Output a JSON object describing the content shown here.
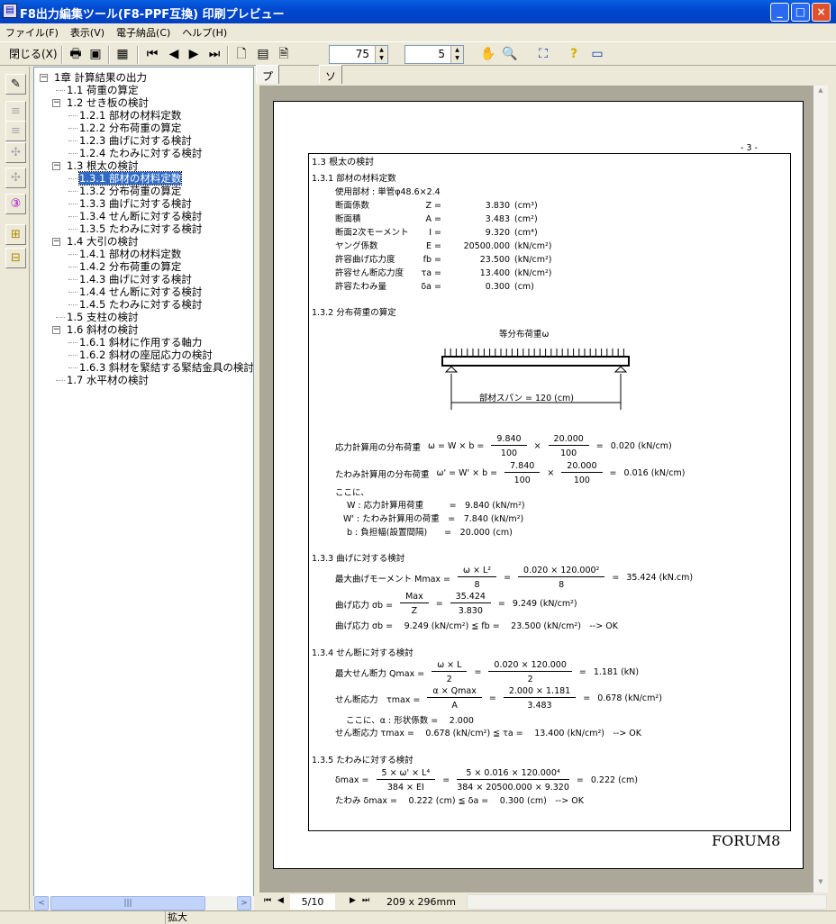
{
  "window": {
    "title": "F8出力編集ツール(F8-PPF互換) 印刷プレビュー",
    "minimize": "_",
    "maximize": "□",
    "close": "×"
  },
  "menu": [
    "ファイル(F)",
    "表示(V)",
    "電子納品(C)",
    "ヘルプ(H)"
  ],
  "toolbar": {
    "close_label": "閉じる(X)",
    "zoom_value": "75",
    "page_value": "5",
    "icons": {
      "print": "printer-icon",
      "save": "save-icon",
      "export": "export-icon",
      "first": "first-page-icon",
      "prev": "prev-page-icon",
      "next": "next-page-icon",
      "last": "last-page-icon",
      "page1": "page-single-icon",
      "page2": "page-double-icon",
      "page3": "page-fold-icon",
      "hand": "hand-icon",
      "zoom": "magnifier-icon",
      "fit": "fit-icon",
      "help": "help-icon",
      "info": "info-icon"
    }
  },
  "tree": [
    {
      "label": "1章 計算結果の出力",
      "level": 0,
      "expander": true
    },
    {
      "label": "1.1 荷重の算定",
      "level": 1
    },
    {
      "label": "1.2 せき板の検討",
      "level": 1,
      "expander": true
    },
    {
      "label": "1.2.1 部材の材料定数",
      "level": 2
    },
    {
      "label": "1.2.2 分布荷重の算定",
      "level": 2
    },
    {
      "label": "1.2.3 曲げに対する検討",
      "level": 2
    },
    {
      "label": "1.2.4 たわみに対する検討",
      "level": 2
    },
    {
      "label": "1.3 根太の検討",
      "level": 1,
      "expander": true
    },
    {
      "label": "1.3.1 部材の材料定数",
      "level": 2,
      "selected": true
    },
    {
      "label": "1.3.2 分布荷重の算定",
      "level": 2
    },
    {
      "label": "1.3.3 曲げに対する検討",
      "level": 2
    },
    {
      "label": "1.3.4 せん断に対する検討",
      "level": 2
    },
    {
      "label": "1.3.5 たわみに対する検討",
      "level": 2
    },
    {
      "label": "1.4 大引の検討",
      "level": 1,
      "expander": true
    },
    {
      "label": "1.4.1 部材の材料定数",
      "level": 2
    },
    {
      "label": "1.4.2 分布荷重の算定",
      "level": 2
    },
    {
      "label": "1.4.3 曲げに対する検討",
      "level": 2
    },
    {
      "label": "1.4.4 せん断に対する検討",
      "level": 2
    },
    {
      "label": "1.4.5 たわみに対する検討",
      "level": 2
    },
    {
      "label": "1.5 支柱の検討",
      "level": 1
    },
    {
      "label": "1.6 斜材の検討",
      "level": 1,
      "expander": true
    },
    {
      "label": "1.6.1 斜材に作用する軸力",
      "level": 2
    },
    {
      "label": "1.6.2 斜材の座屈応力の検討",
      "level": 2
    },
    {
      "label": "1.6.3 斜材を緊結する緊結金具の検討",
      "level": 2
    },
    {
      "label": "1.7 水平材の検討",
      "level": 1
    }
  ],
  "tabs": [
    "プレビュー",
    "ソース"
  ],
  "document": {
    "page_number": "- 3 -",
    "heading": "1.3 根太の検討",
    "s1": {
      "title": "1.3.1 部材の材料定数",
      "member": "使用部材 : 単管φ48.6×2.4",
      "rows": [
        {
          "label": "断面係数",
          "sym": "Z =",
          "value": "3.830",
          "unit": "(cm³)"
        },
        {
          "label": "断面積",
          "sym": "A =",
          "value": "3.483",
          "unit": "(cm²)"
        },
        {
          "label": "断面2次モーメント",
          "sym": "I =",
          "value": "9.320",
          "unit": "(cm⁴)"
        },
        {
          "label": "ヤング係数",
          "sym": "E =",
          "value": "20500.000",
          "unit": "(kN/cm²)"
        },
        {
          "label": "許容曲げ応力度",
          "sym": "fb =",
          "value": "23.500",
          "unit": "(kN/cm²)"
        },
        {
          "label": "許容せん断応力度",
          "sym": "τa =",
          "value": "13.400",
          "unit": "(kN/cm²)"
        },
        {
          "label": "許容たわみ量",
          "sym": "δa =",
          "value": "0.300",
          "unit": "(cm)"
        }
      ]
    },
    "s2": {
      "title": "1.3.2 分布荷重の算定",
      "load_label": "等分布荷重ω",
      "span_label": "部材スパン = 120 (cm)",
      "f1": [
        {
          "t": "応力計算用の分布荷重"
        },
        {
          "t": "ω = W × b ="
        },
        {
          "n": "9.840",
          "d": "100"
        },
        {
          "t": "×"
        },
        {
          "n": "20.000",
          "d": "100"
        },
        {
          "t": "="
        },
        {
          "t": "0.020 (kN/cm)"
        }
      ],
      "f2": [
        {
          "t": "たわみ計算用の分布荷重"
        },
        {
          "t": "ω' = W' × b ="
        },
        {
          "n": "7.840",
          "d": "100"
        },
        {
          "t": "×"
        },
        {
          "n": "20.000",
          "d": "100"
        },
        {
          "t": "="
        },
        {
          "t": "0.016 (kN/cm)"
        }
      ],
      "where": "ここに、",
      "defs": [
        "W : 応力計算用荷重　　　=　9.840 (kN/m²)",
        "W' : たわみ計算用の荷重　=　7.840 (kN/m²)",
        "b : 負担幅(設置間隔)　　=　20.000 (cm)"
      ]
    },
    "s3": {
      "title": "1.3.3 曲げに対する検討",
      "f1": [
        {
          "t": "最大曲げモーメント Mmax ="
        },
        {
          "n": "ω × L²",
          "d": "8"
        },
        {
          "t": "="
        },
        {
          "n": "0.020 × 120.000²",
          "d": "8"
        },
        {
          "t": "="
        },
        {
          "t": "35.424 (kN.cm)"
        }
      ],
      "f2": [
        {
          "t": "曲げ応力 σb ="
        },
        {
          "n": "Max",
          "d": "Z"
        },
        {
          "t": "="
        },
        {
          "n": "35.424",
          "d": "3.830"
        },
        {
          "t": "="
        },
        {
          "t": "9.249 (kN/cm²)"
        }
      ],
      "check": "曲げ応力 σb =　 9.249 (kN/cm²) ≦ fb =　 23.500 (kN/cm²)　--> OK"
    },
    "s4": {
      "title": "1.3.4 せん断に対する検討",
      "f1": [
        {
          "t": "最大せん断力 Qmax ="
        },
        {
          "n": "ω × L",
          "d": "2"
        },
        {
          "t": "="
        },
        {
          "n": "0.020 × 120.000",
          "d": "2"
        },
        {
          "t": "="
        },
        {
          "t": "1.181 (kN)"
        }
      ],
      "f2": [
        {
          "t": "せん断応力　τmax ="
        },
        {
          "n": "α × Qmax",
          "d": "A"
        },
        {
          "t": "="
        },
        {
          "n": "2.000 × 1.181",
          "d": "3.483"
        },
        {
          "t": "="
        },
        {
          "t": "0.678 (kN/cm²)"
        }
      ],
      "where": "ここに、α : 形状係数 =　 2.000",
      "check": "せん断応力 τmax =　 0.678 (kN/cm²) ≦ τa =　 13.400 (kN/cm²)　--> OK"
    },
    "s5": {
      "title": "1.3.5 たわみに対する検討",
      "f1": [
        {
          "t": "δmax ="
        },
        {
          "n": "5 × ω' × L⁴",
          "d": "384 × EI"
        },
        {
          "t": "="
        },
        {
          "n": "5 × 0.016 × 120.000⁴",
          "d": "384 × 20500.000 × 9.320"
        },
        {
          "t": "="
        },
        {
          "t": "0.222 (cm)"
        }
      ],
      "check": "たわみ δmax =　 0.222 (cm) ≦ δa =　 0.300 (cm)　--> OK"
    },
    "logo": "FORUM8"
  },
  "bottom": {
    "page_field": "5/10",
    "paper_size": "209 x 296mm"
  },
  "status": {
    "text": "拡大"
  }
}
